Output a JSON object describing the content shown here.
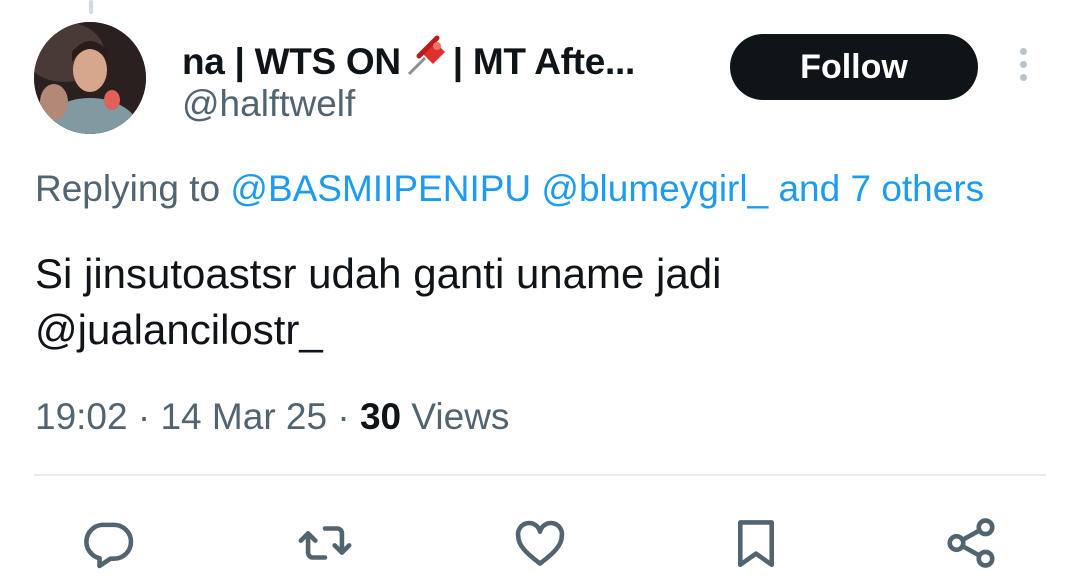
{
  "header": {
    "display_name_part1": "na | WTS ON",
    "display_name_part2": "| MT Afte...",
    "pin_icon": "pushpin-icon",
    "handle": "@halftwelf",
    "follow_label": "Follow"
  },
  "reply": {
    "prefix": "Replying to ",
    "mention1": "@BASMIIPENIPU",
    "mention2": "@blumeygirl_",
    "others": "and 7 others"
  },
  "tweet": {
    "text": "Si jinsutoastsr udah ganti uname jadi\n@jualancilostr_"
  },
  "meta": {
    "time": "19:02",
    "date": "14 Mar 25",
    "views_count": "30",
    "views_label": "Views"
  },
  "actions": [
    {
      "icon": "reply-icon"
    },
    {
      "icon": "retweet-icon"
    },
    {
      "icon": "like-icon"
    },
    {
      "icon": "bookmark-icon"
    },
    {
      "icon": "share-icon"
    }
  ],
  "colors": {
    "text": "#0f1419",
    "secondary": "#536471",
    "link": "#1d9bf0",
    "button_bg": "#0f1419",
    "icon": "#536471"
  }
}
